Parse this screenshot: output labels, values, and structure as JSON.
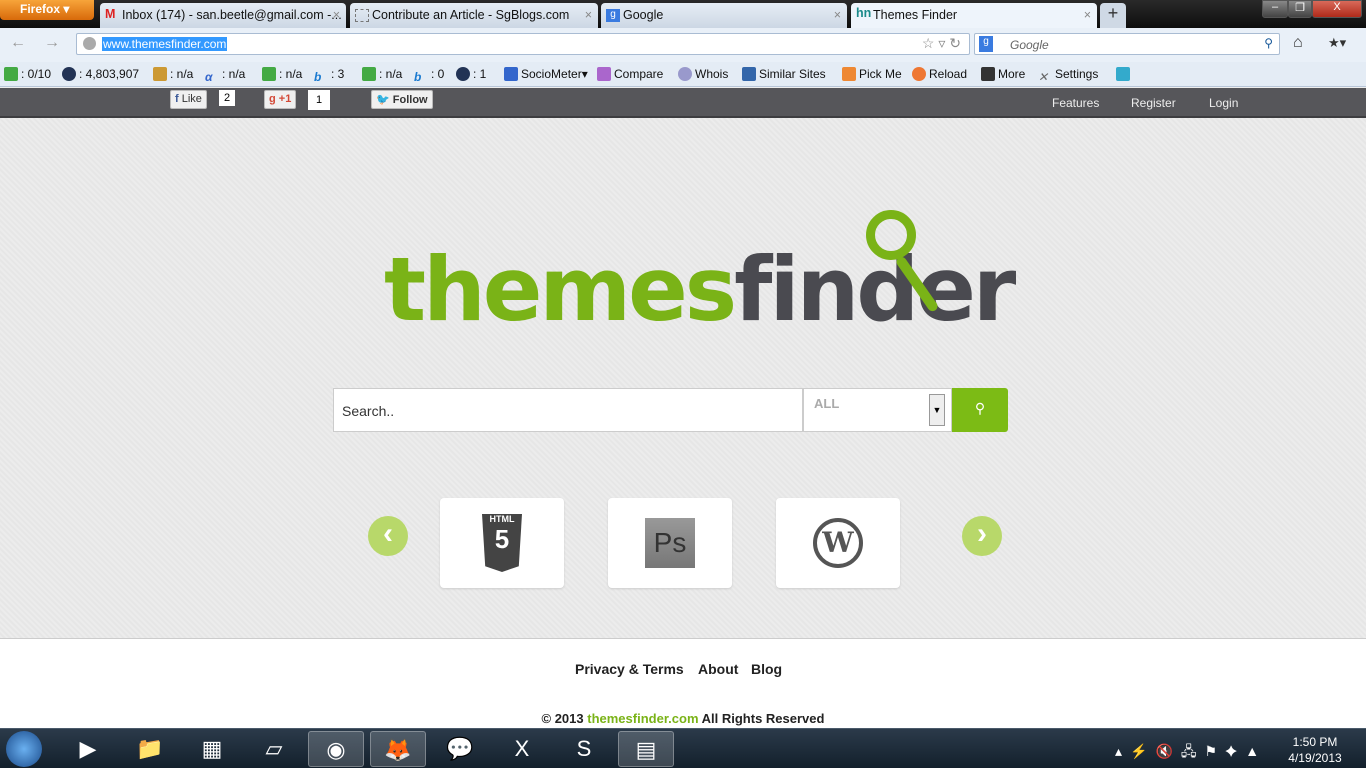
{
  "browser": {
    "menu_label": "Firefox",
    "tabs": [
      {
        "title": "Inbox (174) - san.beetle@gmail.com -..."
      },
      {
        "title": "Contribute an Article - SgBlogs.com"
      },
      {
        "title": "Google"
      },
      {
        "title": "Themes Finder",
        "active": true
      }
    ],
    "url": "www.themesfinder.com",
    "search_placeholder": "Google"
  },
  "toolbar": {
    "items": [
      ": 0/10",
      ": 4,803,907",
      ": n/a",
      ": n/a",
      ": n/a",
      ": 3",
      ": n/a",
      ": 0",
      ": 1",
      "SocioMeter",
      "Compare",
      "Whois",
      "Similar Sites",
      "Pick Me",
      "Reload",
      "More",
      "Settings"
    ]
  },
  "site": {
    "social": {
      "like_label": "Like",
      "like_count": "2",
      "plus_label": "+1",
      "plus_count": "1",
      "follow_label": "Follow"
    },
    "nav": [
      "Features",
      "Register",
      "Login"
    ],
    "logo": {
      "part1": "themes",
      "part2": "finder",
      "color1": "#7ab317",
      "color2": "#4a4a50"
    },
    "search": {
      "placeholder": "Search..",
      "category": "ALL"
    },
    "cards": [
      {
        "label": "HTML",
        "icon": "html5-icon"
      },
      {
        "label": "Ps",
        "icon": "photoshop-icon"
      },
      {
        "label": "W",
        "icon": "wordpress-icon"
      }
    ],
    "footer": {
      "links": [
        "Privacy & Terms",
        "About",
        "Blog"
      ],
      "copy_pre": "© 2013 ",
      "copy_site": "themesfinder.com",
      "copy_post": " All Rights Reserved"
    }
  },
  "taskbar": {
    "time": "1:50 PM",
    "date": "4/19/2013"
  }
}
